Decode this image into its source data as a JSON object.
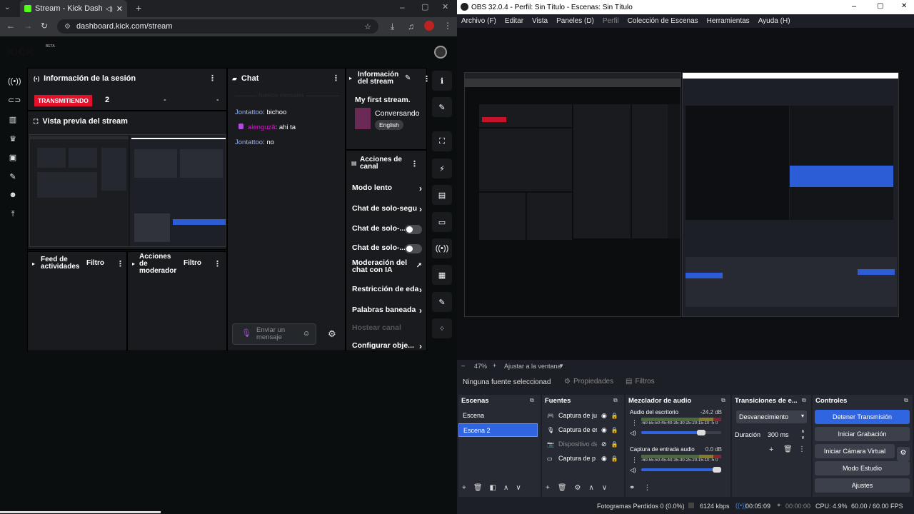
{
  "chrome": {
    "tab_title": "Stream - Kick Dashboard",
    "url": "dashboard.kick.com/stream",
    "kick_logo": "KICK",
    "kick_beta": "BETA",
    "session": {
      "title": "Información de la sesión",
      "live_badge": "TRANSMITIENDO",
      "viewers": "2",
      "stat2": "-",
      "stat3": "-",
      "preview_title": "Vista previa del stream"
    },
    "activity_feed": {
      "title": "Feed de actividades",
      "filter": "Filtro"
    },
    "mod_actions": {
      "title": "Acciones de moderador",
      "filter": "Filtro"
    },
    "chat": {
      "title": "Chat",
      "divider": "Nuevos mensajes",
      "messages": [
        {
          "user": "Jontattoo",
          "text": "bichoo",
          "color": "#8fb3ff"
        },
        {
          "user": "alenguzã",
          "text": "ahi ta",
          "color": "#d21cc8"
        },
        {
          "user": "Jontattoo",
          "text": "no",
          "color": "#8fb3ff"
        }
      ],
      "input_placeholder": "Enviar un mensaje"
    },
    "stream_info": {
      "title": "Información del stream",
      "stream_title": "My first stream.",
      "category": "Conversando",
      "language": "English"
    },
    "channel_actions": {
      "title": "Acciones de canal",
      "items": [
        {
          "label": "Modo lento",
          "kind": "chevron"
        },
        {
          "label": "Chat de solo-segu",
          "kind": "chevron"
        },
        {
          "label": "Chat de solo-...",
          "kind": "toggle"
        },
        {
          "label": "Chat de solo-...",
          "kind": "toggle"
        },
        {
          "label": "Moderación del chat con IA",
          "kind": "external"
        },
        {
          "label": "Restricción de eda",
          "kind": "chevron"
        },
        {
          "label": "Palabras baneada",
          "kind": "chevron"
        },
        {
          "label": "Hostear canal",
          "kind": "none"
        },
        {
          "label": "Configurar obje...",
          "kind": "chevron"
        }
      ]
    }
  },
  "obs": {
    "title": "OBS 32.0.4 - Perfil: Sin Título - Escenas: Sin Título",
    "menu": [
      "Archivo (F)",
      "Editar",
      "Vista",
      "Paneles (D)",
      "Perfil",
      "Colección de Escenas",
      "Herramientas",
      "Ayuda (H)"
    ],
    "zoom": "47%",
    "fit_label": "Ajustar a la ventana",
    "no_source": "Ninguna fuente seleccionad",
    "properties": "Propiedades",
    "filters": "Filtros",
    "docks": {
      "scenes": "Escenas",
      "sources": "Fuentes",
      "mixer": "Mezclador de audio",
      "transitions": "Transiciones de e...",
      "controls": "Controles"
    },
    "scenes": [
      "Escena",
      "Escena 2"
    ],
    "sources": [
      "Captura de ju",
      "Captura de er",
      "Dispositivo de",
      "Captura de p"
    ],
    "mixer": [
      {
        "name": "Audio del escritorio",
        "db": "-24.2 dB",
        "level": 0.8
      },
      {
        "name": "Captura de entrada audio",
        "db": "0.0 dB",
        "level": 1.0
      }
    ],
    "meter_scale": "-60-55-50-45-40-35-30-25-20-15-10 -5 0",
    "transition": "Desvanecimiento",
    "duration_label": "Duración",
    "duration_value": "300 ms",
    "controls": [
      "Detener Transmisión",
      "Iniciar Grabación",
      "Iniciar Cámara Virtual",
      "Modo Estudio",
      "Ajustes"
    ],
    "status": {
      "dropped": "Fotogramas Perdidos 0 (0.0%)",
      "bitrate": "6124 kbps",
      "stream_time": "00:05:09",
      "rec_time": "00:00:00",
      "cpu": "CPU: 4.9%",
      "fps": "60.00 / 60.00 FPS"
    },
    "colors": {
      "accent": "#2f65e0",
      "live": "#e3112b"
    }
  }
}
